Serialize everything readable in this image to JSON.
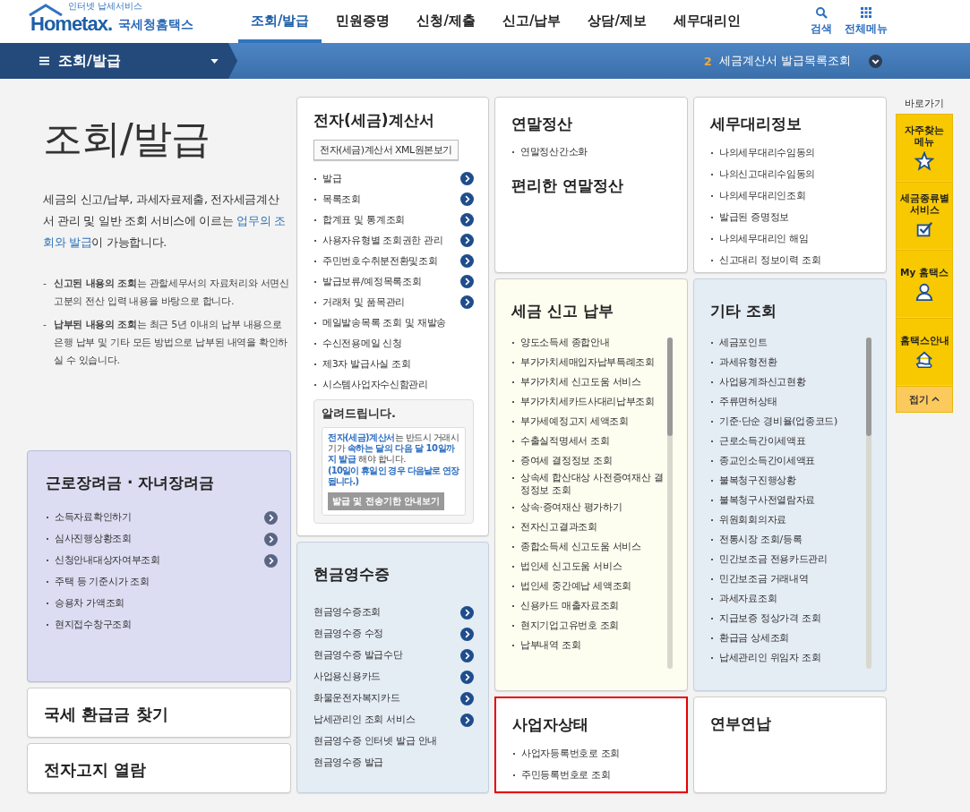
{
  "header": {
    "logo_caption": "인터넷 납세서비스",
    "logo": "Hometax.",
    "brand": "국세청홈택스",
    "menu": [
      {
        "label": "조회/발급",
        "selected": true
      },
      {
        "label": "민원증명",
        "selected": false
      },
      {
        "label": "신청/제출",
        "selected": false
      },
      {
        "label": "신고/납부",
        "selected": false
      },
      {
        "label": "상담/제보",
        "selected": false
      },
      {
        "label": "세무대리인",
        "selected": false
      }
    ],
    "tools": [
      {
        "label": "검색",
        "kind": "search"
      },
      {
        "label": "전체메뉴",
        "kind": "grid"
      }
    ]
  },
  "subnav": {
    "title": "조회/발급",
    "count": "2",
    "recent": "세금계산서 발급목록조회"
  },
  "intro": {
    "title": "조회/발급",
    "description": [
      {
        "text": "세금의 신고/납부, 과세자료제출, 전자세금계산서 관리 및 일반 조회 서비스에 이르는 ",
        "highlight": false
      },
      {
        "text": "업무의 조회와 발급",
        "highlight": true
      },
      {
        "text": "이 가능합니다.",
        "highlight": false
      }
    ],
    "notes": [
      {
        "marker": "-",
        "text": "**신고된 내용의 조회**는 관할세무서의 자료처리와 서면신고분의 전산 입력 내용을 바탕으로 합니다."
      },
      {
        "marker": "-",
        "text": "**납부된 내용의 조회**는 최근 5년 이내의 납부 내용으로 은행 납부 및 기타 모든 방법으로 납부된 내역을 확인하실 수 있습니다."
      }
    ]
  },
  "columns": [
    {
      "cards": [
        {
          "title": "근로장려금 · 자녀장려금",
          "highlighted": false,
          "bullets": true,
          "items": [
            {
              "label": "소득자료확인하기",
              "arrow": true
            },
            {
              "label": "심사진행상황조회",
              "arrow": true
            },
            {
              "label": "신청안내대상자여부조회",
              "arrow": true
            },
            {
              "label": "주택 등 기준시가 조회",
              "arrow": false
            },
            {
              "label": "승용차 가액조회",
              "arrow": false
            },
            {
              "label": "현지접수창구조회",
              "arrow": false
            }
          ]
        },
        {
          "title": "국세 환급금 찾기",
          "highlighted": false
        },
        {
          "title": "전자고지 열람",
          "highlighted": false
        }
      ]
    },
    {
      "cards": [
        {
          "title": "전자(세금)계산서",
          "highlighted": false,
          "bullets": true,
          "button": "전자(세금)계산서 XML원본보기",
          "items": [
            {
              "label": "발급",
              "arrow": true
            },
            {
              "label": "목록조회",
              "arrow": true
            },
            {
              "label": "합계표 및 통계조회",
              "arrow": true
            },
            {
              "label": "사용자유형별 조회권한 관리",
              "arrow": true
            },
            {
              "label": "주민번호수취분전환및조회",
              "arrow": true
            },
            {
              "label": "발급보류/예정목록조회",
              "arrow": true
            },
            {
              "label": "거래처 및 품목관리",
              "arrow": true
            },
            {
              "label": "메일발송목록 조회 및 재발송",
              "arrow": false
            },
            {
              "label": "수신전용메일 신청",
              "arrow": false
            },
            {
              "label": "제3자 발급사실 조회",
              "arrow": false
            },
            {
              "label": "시스템사업자수신함관리",
              "arrow": false
            }
          ],
          "notice": {
            "title": "알려드립니다.",
            "text": [
              {
                "text": "전자(세금)계산서",
                "highlight": true
              },
              {
                "text": "는 반드시 거래시기가 ",
                "highlight": false
              },
              {
                "text": "속하는 달의 다음 달 10일까지 발급",
                "highlight": true
              },
              {
                "text": " 해야 합니다.",
                "highlight": false
              }
            ],
            "note": "(10일이 휴일인 경우 다음날로 연장됩니다.)",
            "button": "발급 및 전송기한 안내보기"
          }
        },
        {
          "title": "현금영수증",
          "highlighted": false,
          "bullets": false,
          "items": [
            {
              "label": "현금영수증조회",
              "arrow": true
            },
            {
              "label": "현금영수증 수정",
              "arrow": true
            },
            {
              "label": "현금영수증 발급수단",
              "arrow": true
            },
            {
              "label": "사업용신용카드",
              "arrow": true
            },
            {
              "label": "화물운전자복지카드",
              "arrow": true
            },
            {
              "label": "납세관리인 조회 서비스",
              "arrow": true
            },
            {
              "label": "현금영수증 인터넷 발급 안내",
              "arrow": false
            },
            {
              "label": "현금영수증 발급",
              "arrow": false
            }
          ]
        }
      ]
    },
    {
      "cards": [
        {
          "title": "연말정산",
          "highlighted": false,
          "bullets": true,
          "items": [
            {
              "label": "연말정산간소화",
              "arrow": false
            }
          ],
          "subheading": "편리한 연말정산"
        },
        {
          "title": "세금 신고 납부",
          "highlighted": false,
          "bullets": true,
          "scroll": true,
          "items": [
            {
              "label": "양도소득세 종합안내",
              "arrow": false
            },
            {
              "label": "부가가치세매입자납부특례조회",
              "arrow": false
            },
            {
              "label": "부가가치세 신고도움 서비스",
              "arrow": false
            },
            {
              "label": "부가가치세카드사대리납부조회",
              "arrow": false
            },
            {
              "label": "부가세예정고지 세액조회",
              "arrow": false
            },
            {
              "label": "수출실적명세서 조회",
              "arrow": false
            },
            {
              "label": "증여세 결정정보 조회",
              "arrow": false
            },
            {
              "label": "상속세 합산대상 사전증여재산 결정정보 조회",
              "arrow": false
            },
            {
              "label": "상속·증여재산 평가하기",
              "arrow": false
            },
            {
              "label": "전자신고결과조회",
              "arrow": false
            },
            {
              "label": "종합소득세 신고도움 서비스",
              "arrow": false
            },
            {
              "label": "법인세 신고도움 서비스",
              "arrow": false
            },
            {
              "label": "법인세 중간예납 세액조회",
              "arrow": false
            },
            {
              "label": "신용카드 매출자료조회",
              "arrow": false
            },
            {
              "label": "현지기업고유번호 조회",
              "arrow": false
            },
            {
              "label": "납부내역 조회",
              "arrow": false
            }
          ]
        },
        {
          "title": "사업자상태",
          "highlighted": true,
          "bullets": true,
          "items": [
            {
              "label": "사업자등록번호로 조회",
              "arrow": false
            },
            {
              "label": "주민등록번호로 조회",
              "arrow": false
            }
          ]
        }
      ]
    },
    {
      "cards": [
        {
          "title": "세무대리정보",
          "highlighted": false,
          "bullets": true,
          "items": [
            {
              "label": "나의세무대리수임동의",
              "arrow": false
            },
            {
              "label": "나의신고대리수임동의",
              "arrow": false
            },
            {
              "label": "나의세무대리인조회",
              "arrow": false
            },
            {
              "label": "발급된 증명정보",
              "arrow": false
            },
            {
              "label": "나의세무대리인 해임",
              "arrow": false
            },
            {
              "label": "신고대리 정보이력 조회",
              "arrow": false
            }
          ]
        },
        {
          "title": "기타 조회",
          "highlighted": false,
          "bullets": true,
          "scroll": true,
          "items": [
            {
              "label": "세금포인트",
              "arrow": false
            },
            {
              "label": "과세유형전환",
              "arrow": false
            },
            {
              "label": "사업용계좌신고현황",
              "arrow": false
            },
            {
              "label": "주류면허상태",
              "arrow": false
            },
            {
              "label": "기준·단순 경비율(업종코드)",
              "arrow": false
            },
            {
              "label": "근로소득간이세액표",
              "arrow": false
            },
            {
              "label": "종교인소득간이세액표",
              "arrow": false
            },
            {
              "label": "불복청구진행상황",
              "arrow": false
            },
            {
              "label": "불복청구사전열람자료",
              "arrow": false
            },
            {
              "label": "위원회회의자료",
              "arrow": false
            },
            {
              "label": "전통시장 조회/등록",
              "arrow": false
            },
            {
              "label": "민간보조금 전용카드관리",
              "arrow": false
            },
            {
              "label": "민간보조금 거래내역",
              "arrow": false
            },
            {
              "label": "과세자료조회",
              "arrow": false
            },
            {
              "label": "지급보증 정상가격 조회",
              "arrow": false
            },
            {
              "label": "환급금 상세조회",
              "arrow": false
            },
            {
              "label": "납세관리인 위임자 조회",
              "arrow": false
            }
          ]
        },
        {
          "title": "연부연납",
          "highlighted": false
        }
      ]
    }
  ],
  "quick": {
    "title": "바로가기",
    "links": [
      {
        "label": "자주찾는 메뉴",
        "kind": "star"
      },
      {
        "label": "세금종류별 서비스",
        "kind": "check"
      },
      {
        "label": "My 홈택스",
        "kind": "person"
      },
      {
        "label": "홈택스안내",
        "kind": "house"
      }
    ],
    "fold": "접기"
  }
}
